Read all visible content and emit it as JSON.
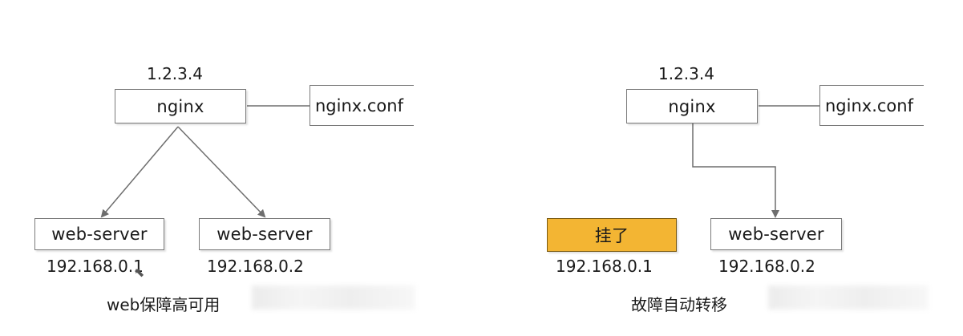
{
  "left_diagram": {
    "ip_top": "1.2.3.4",
    "proxy_label": "nginx",
    "config_label": "nginx.conf",
    "server_1_label": "web-server",
    "server_1_ip": "192.168.0.1",
    "server_2_label": "web-server",
    "server_2_ip": "192.168.0.2",
    "caption": "web保障高可用"
  },
  "right_diagram": {
    "ip_top": "1.2.3.4",
    "proxy_label": "nginx",
    "config_label": "nginx.conf",
    "server_1_label": "挂了",
    "server_1_ip": "192.168.0.1",
    "server_2_label": "web-server",
    "server_2_ip": "192.168.0.2",
    "caption": "故障自动转移"
  },
  "colors": {
    "failed_box_fill": "#f3b533",
    "line_color": "#6e6e6e"
  }
}
